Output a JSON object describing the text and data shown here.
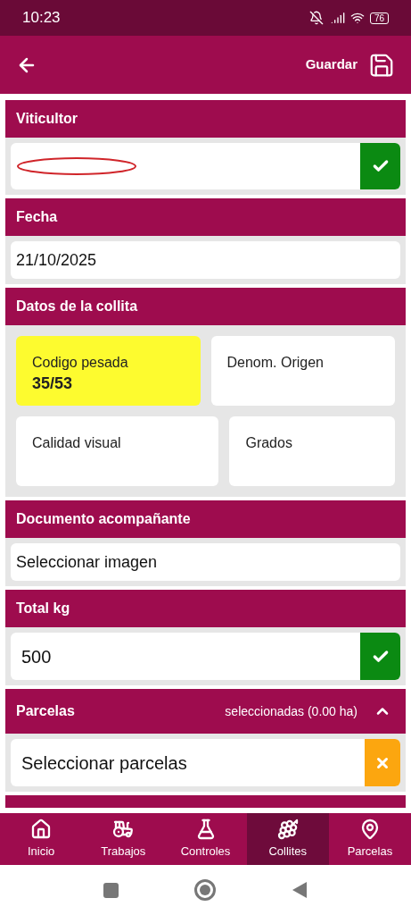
{
  "status_bar": {
    "time": "10:23",
    "battery": "76"
  },
  "app_bar": {
    "save_label": "Guardar"
  },
  "sections": [
    {
      "title": "Viticultor",
      "kind": "input",
      "valid": true,
      "redacted": true
    },
    {
      "title": "Fecha",
      "kind": "input",
      "value": "21/10/2025"
    },
    {
      "title": "Datos de la collita",
      "kind": "tiles",
      "tiles": [
        {
          "label": "Codigo pesada",
          "value": "35/53",
          "highlighted": true
        },
        {
          "label": "Denom. Origen",
          "highlighted": false
        },
        {
          "label": "Calidad visual",
          "highlighted": false
        },
        {
          "label": "Grados",
          "highlighted": false
        }
      ]
    },
    {
      "title": "Documento acompañante",
      "kind": "input",
      "value": "Seleccionar imagen"
    },
    {
      "title": "Total kg",
      "kind": "input",
      "value": "500",
      "valid": true,
      "large": true
    },
    {
      "title": "Parcelas",
      "kind": "input",
      "subtitle": "seleccionadas (0.00 ha)",
      "expanded": true,
      "value": "Seleccionar parcelas",
      "valid": false,
      "large": true
    }
  ],
  "nav": [
    {
      "label": "Inicio",
      "kind": "home",
      "selected": false
    },
    {
      "label": "Trabajos",
      "kind": "tractor",
      "selected": false
    },
    {
      "label": "Controles",
      "kind": "flask",
      "selected": false
    },
    {
      "label": "Collites",
      "kind": "grapes",
      "selected": true
    },
    {
      "label": "Parcelas",
      "kind": "pin",
      "selected": false
    }
  ]
}
